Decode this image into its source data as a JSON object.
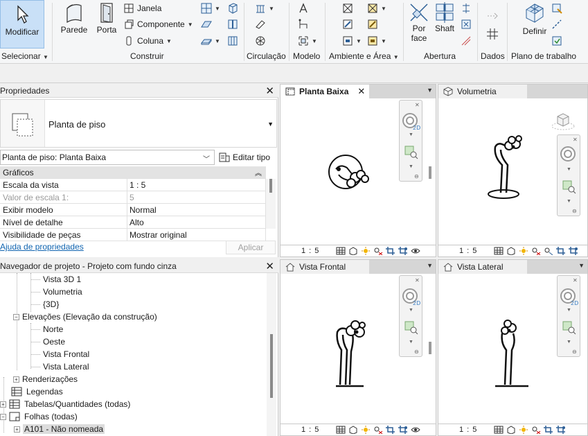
{
  "ribbon": {
    "select": {
      "label": "Modificar",
      "group": "Selecionar"
    },
    "construir": {
      "group": "Construir",
      "parede": "Parede",
      "porta": "Porta",
      "janela": "Janela",
      "componente": "Componente",
      "coluna": "Coluna"
    },
    "circulacao": {
      "group": "Circulação"
    },
    "modelo": {
      "group": "Modelo"
    },
    "ambiente": {
      "group": "Ambiente e Área"
    },
    "abertura": {
      "group": "Abertura",
      "porface": "Por face",
      "shaft": "Shaft"
    },
    "dados": {
      "group": "Dados"
    },
    "plano": {
      "group": "Plano de trabalho",
      "definir": "Definir"
    }
  },
  "properties": {
    "title": "Propriedades",
    "type_name": "Planta de piso",
    "instance_select": "Planta de piso: Planta Baixa",
    "edit_type": "Editar tipo",
    "section": "Gráficos",
    "rows": [
      {
        "key": "Escala da vista",
        "value": "1 : 5",
        "disabled": false
      },
      {
        "key": "Valor de escala    1:",
        "value": "5",
        "disabled": true
      },
      {
        "key": "Exibir modelo",
        "value": "Normal",
        "disabled": false
      },
      {
        "key": "Nível de detalhe",
        "value": "Alto",
        "disabled": false
      },
      {
        "key": "Visibilidade de peças",
        "value": "Mostrar original",
        "disabled": false
      }
    ],
    "help_link": "Ajuda de propriedades",
    "apply": "Aplicar"
  },
  "navigator": {
    "title": "Navegador de projeto - Projeto com fundo cinza",
    "items": [
      {
        "label": "Vista 3D 1"
      },
      {
        "label": "Volumetria"
      },
      {
        "label": "{3D}"
      },
      {
        "label": "Elevações (Elevação da construção)"
      },
      {
        "label": "Norte"
      },
      {
        "label": "Oeste"
      },
      {
        "label": "Vista Frontal"
      },
      {
        "label": "Vista Lateral"
      },
      {
        "label": "Renderizações"
      },
      {
        "label": "Legendas"
      },
      {
        "label": "Tabelas/Quantidades (todas)"
      },
      {
        "label": "Folhas (todas)"
      },
      {
        "label": "A101 - Não nomeada"
      }
    ]
  },
  "views": {
    "planta": {
      "title": "Planta Baixa",
      "scale": "1 : 5"
    },
    "volumetria": {
      "title": "Volumetria",
      "scale": "1 : 5"
    },
    "frontal": {
      "title": "Vista Frontal",
      "scale": "1 : 5"
    },
    "lateral": {
      "title": "Vista Lateral",
      "scale": "1 : 5"
    }
  }
}
